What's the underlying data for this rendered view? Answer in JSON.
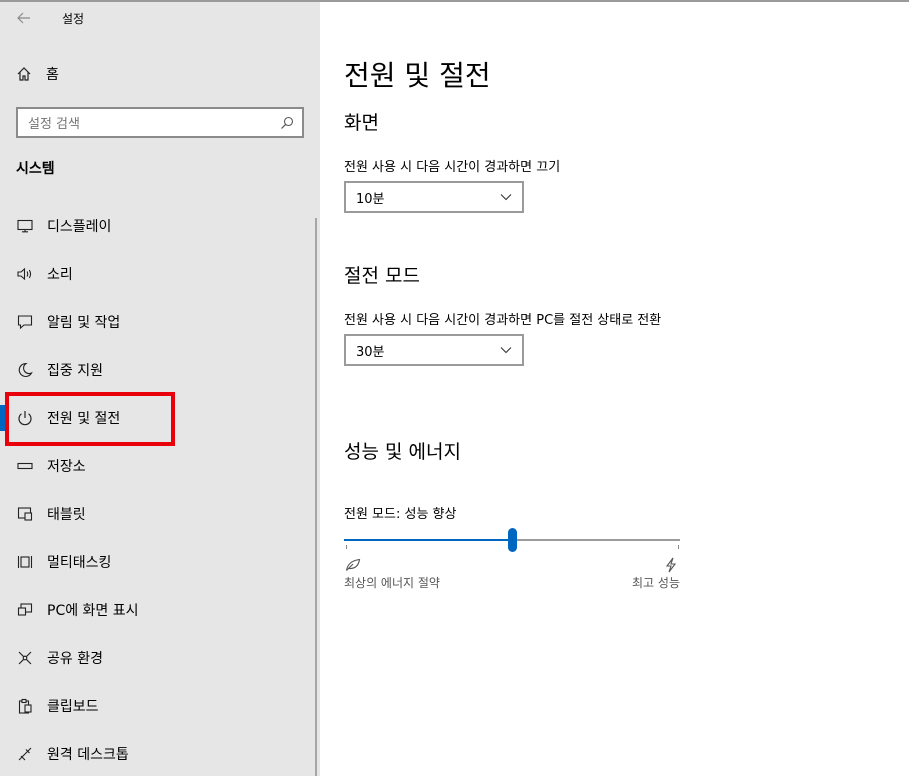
{
  "window": {
    "title": "설정"
  },
  "sidebar": {
    "home_label": "홈",
    "search_placeholder": "설정 검색",
    "section_heading": "시스템",
    "items": [
      {
        "label": "디스플레이",
        "icon": "monitor-icon"
      },
      {
        "label": "소리",
        "icon": "speaker-icon"
      },
      {
        "label": "알림 및 작업",
        "icon": "notification-icon"
      },
      {
        "label": "집중 지원",
        "icon": "moon-icon"
      },
      {
        "label": "전원 및 절전",
        "icon": "power-icon",
        "selected": true
      },
      {
        "label": "저장소",
        "icon": "storage-icon"
      },
      {
        "label": "태블릿",
        "icon": "tablet-icon"
      },
      {
        "label": "멀티태스킹",
        "icon": "multitasking-icon"
      },
      {
        "label": "PC에 화면 표시",
        "icon": "project-icon"
      },
      {
        "label": "공유 환경",
        "icon": "share-icon"
      },
      {
        "label": "클립보드",
        "icon": "clipboard-icon"
      },
      {
        "label": "원격 데스크톱",
        "icon": "remote-desktop-icon"
      }
    ]
  },
  "main": {
    "title": "전원 및 절전",
    "screen": {
      "title": "화면",
      "label": "전원 사용 시 다음 시간이 경과하면 끄기",
      "value": "10분"
    },
    "sleep": {
      "title": "절전 모드",
      "label": "전원 사용 시 다음 시간이 경과하면 PC를 절전 상태로 전환",
      "value": "30분"
    },
    "power": {
      "title": "성능 및 에너지",
      "mode_label": "전원 모드: 성능 향상",
      "slider_value": 0.5,
      "left_label": "최상의 에너지 절약",
      "right_label": "최고 성능"
    }
  },
  "colors": {
    "accent": "#0067c0",
    "highlight": "#e8000b",
    "sidebar_bg": "#e6e6e6"
  }
}
